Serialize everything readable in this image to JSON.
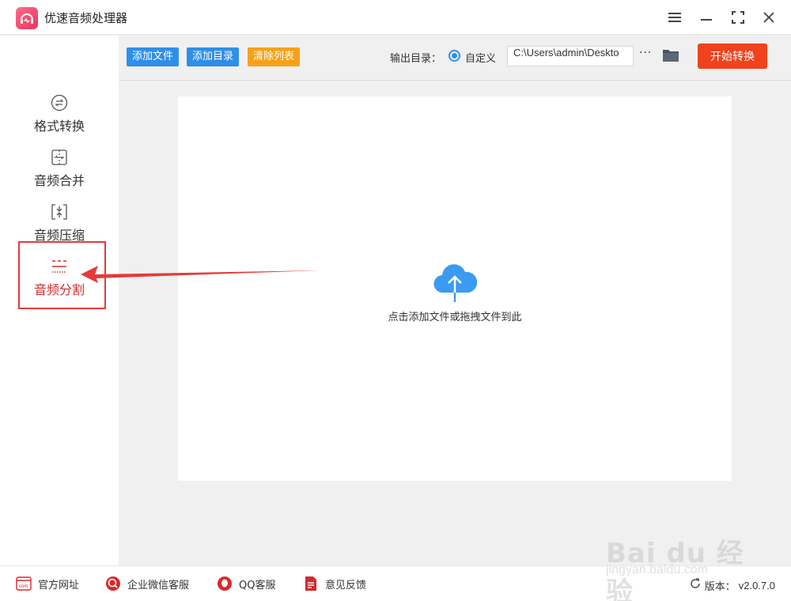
{
  "app": {
    "title": "优速音频处理器"
  },
  "sidebar": {
    "items": [
      {
        "label": "格式转换",
        "icon": "format-convert-icon"
      },
      {
        "label": "音频合并",
        "icon": "merge-icon"
      },
      {
        "label": "音频压缩",
        "icon": "compress-icon"
      },
      {
        "label": "音频分割",
        "icon": "split-icon",
        "active": true
      }
    ]
  },
  "toolbar": {
    "add_file": "添加文件",
    "add_dir": "添加目录",
    "clear_list": "清除列表",
    "output_label": "输出目录：",
    "radio_label": "自定义",
    "path_value": "C:\\Users\\admin\\Deskto",
    "more": "···",
    "start": "开始转换"
  },
  "dropzone": {
    "hint": "点击添加文件或拖拽文件到此"
  },
  "footer": {
    "links": [
      {
        "label": "官方网址",
        "icon": "website-icon"
      },
      {
        "label": "企业微信客服",
        "icon": "wechat-service-icon"
      },
      {
        "label": "QQ客服",
        "icon": "qq-icon"
      },
      {
        "label": "意见反馈",
        "icon": "feedback-icon"
      }
    ],
    "version_label": "版本：",
    "version": "v2.0.7.0"
  },
  "watermark": {
    "text": "Bai du 经验",
    "sub": "jingyan.baidu.com"
  },
  "colors": {
    "accent_blue": "#2f8fe8",
    "accent_orange": "#f7a11a",
    "start_red": "#f0421c",
    "highlight_red": "#e43a3a"
  }
}
